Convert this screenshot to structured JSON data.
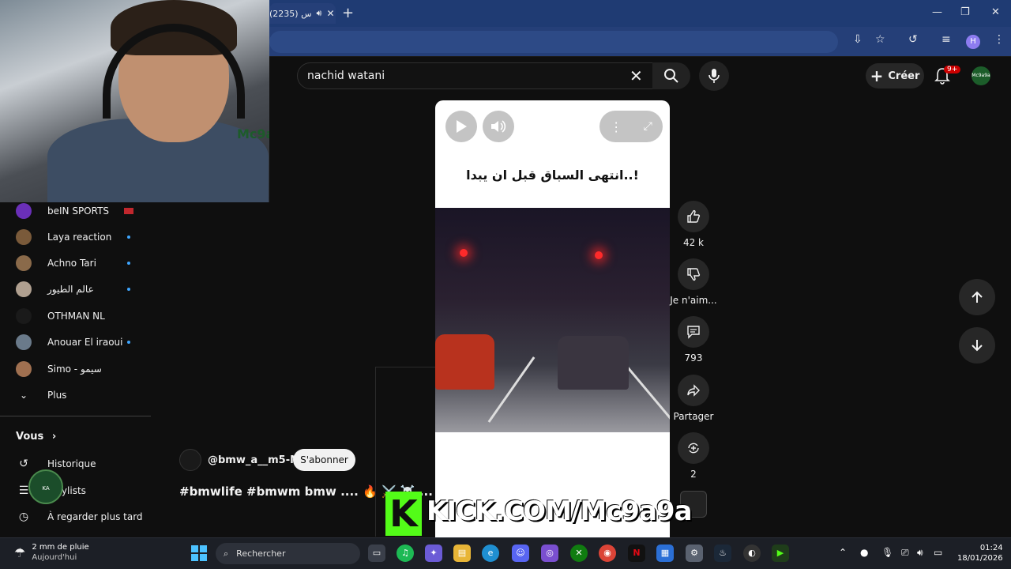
{
  "browser": {
    "tab_title": "(2235) س",
    "new_tab": "+",
    "win_min": "—",
    "win_max": "❐",
    "win_close": "✕",
    "profile_initial": "H"
  },
  "header": {
    "search_value": "nachid watani",
    "create_label": "Créer",
    "notif_badge": "9+",
    "channel_short": "Mc9a9a"
  },
  "webcam": {
    "logo_text": "Mc9a"
  },
  "sidebar": {
    "subscriptions": [
      {
        "label": "beIN SPORTS",
        "color": "#6a2fb8",
        "live": false,
        "flag": true
      },
      {
        "label": "Laya reaction",
        "color": "#7a5a3a",
        "live": true
      },
      {
        "label": "Achno Tari",
        "color": "#8a6a4a",
        "live": true
      },
      {
        "label": "عالم الطيور",
        "color": "#b0a090",
        "live": true
      },
      {
        "label": "OTHMAN NL",
        "color": "#1a1a1a",
        "live": false
      },
      {
        "label": "Anouar El iraoui",
        "color": "#6a7a8a",
        "live": true
      },
      {
        "label": "Simo - سيمو",
        "color": "#a07050",
        "live": false
      }
    ],
    "more_label": "Plus",
    "you_title": "Vous",
    "history_label": "Historique",
    "playlists_label": "Playlists",
    "watch_later_label": "À regarder plus tard",
    "badge_text": "KA"
  },
  "short": {
    "caption": "انتهى السباق قبل ان يبدا..!",
    "channel_handle": "@bmw_a__m5-M",
    "subscribe_label": "S'abonner",
    "title": "#bmwlife #bmwm bmw .... 🔥 ⚔️ ☠️ ... ‹‹"
  },
  "actions": {
    "like_count": "42 k",
    "dislike_label": "Je n'aim...",
    "comments_count": "793",
    "share_label": "Partager",
    "remix_count": "2"
  },
  "overlay": {
    "kick_letter": "K",
    "kick_url": "KICK.COM/Mc9a9a"
  },
  "taskbar": {
    "weather_line1": "2 mm de pluie",
    "weather_line2": "Aujourd'hui",
    "search_placeholder": "Rechercher",
    "time": "01:24",
    "date": "18/01/2026"
  },
  "colors": {
    "yt_bg": "#0f0f0f",
    "browser_chrome": "#1f3b73",
    "kick_green": "#53fc18",
    "live_blue": "#3ea6ff",
    "notif_red": "#cc0000"
  }
}
